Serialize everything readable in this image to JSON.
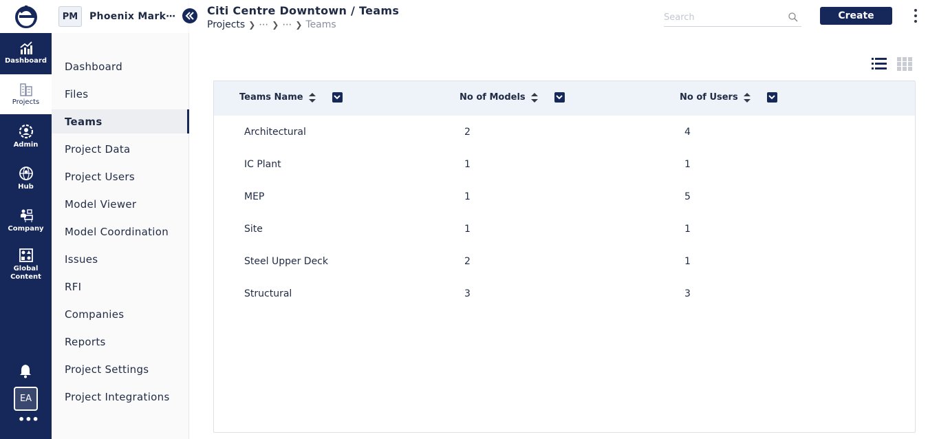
{
  "rail": {
    "items": [
      {
        "label": "Dashboard",
        "icon": "chart-icon"
      },
      {
        "label": "Projects",
        "icon": "buildings-icon"
      },
      {
        "label": "Admin",
        "icon": "user-gear-icon"
      },
      {
        "label": "Hub",
        "icon": "globe-user-icon"
      },
      {
        "label": "Company",
        "icon": "company-desk-icon"
      },
      {
        "label": "Global Content",
        "icon": "shapes-icon"
      }
    ],
    "avatar": "EA",
    "more": "•••"
  },
  "project": {
    "badge": "PM",
    "name": "Phoenix Mark⋯"
  },
  "header": {
    "title": "Citi Centre Downtown / Teams",
    "breadcrumb": {
      "root": "Projects",
      "ellipsis1": "⋯",
      "ellipsis2": "⋯",
      "current": "Teams"
    },
    "search_placeholder": "Search",
    "create_label": "Create"
  },
  "subnav": {
    "items": [
      "Dashboard",
      "Files",
      "Teams",
      "Project Data",
      "Project Users",
      "Model Viewer",
      "Model Coordination",
      "Issues",
      "RFI",
      "Companies",
      "Reports",
      "Project Settings",
      "Project Integrations"
    ],
    "active": "Teams"
  },
  "table": {
    "columns": [
      "Teams Name",
      "No of Models",
      "No of Users"
    ],
    "rows": [
      {
        "name": "Architectural",
        "models": "2",
        "users": "4"
      },
      {
        "name": "IC Plant",
        "models": "1",
        "users": "1"
      },
      {
        "name": "MEP",
        "models": "1",
        "users": "5"
      },
      {
        "name": "Site",
        "models": "1",
        "users": "1"
      },
      {
        "name": "Steel Upper Deck",
        "models": "2",
        "users": "1"
      },
      {
        "name": "Structural",
        "models": "3",
        "users": "3"
      }
    ]
  },
  "colors": {
    "brand": "#16285a",
    "header_bg": "#eef2f9",
    "active_nav": "#eceef2"
  }
}
